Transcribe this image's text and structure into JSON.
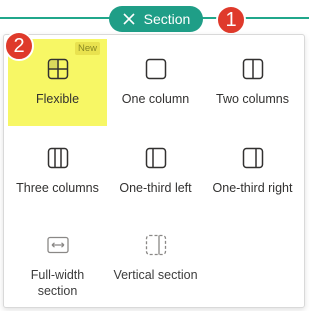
{
  "header": {
    "section_label": "Section",
    "accent_color": "#1f9e87"
  },
  "callouts": {
    "one": "1",
    "two": "2",
    "color": "#df3a2b"
  },
  "layouts": {
    "flexible": {
      "label": "Flexible",
      "badge": "New",
      "icon": "flexible-layout-icon",
      "selected": true
    },
    "one_column": {
      "label": "One column",
      "icon": "one-column-icon"
    },
    "two_columns": {
      "label": "Two columns",
      "icon": "two-columns-icon"
    },
    "three_columns": {
      "label": "Three columns",
      "icon": "three-columns-icon"
    },
    "one_third_left": {
      "label": "One-third left",
      "icon": "one-third-left-icon"
    },
    "one_third_right": {
      "label": "One-third right",
      "icon": "one-third-right-icon"
    },
    "full_width": {
      "label_line1": "Full-width",
      "label_line2": "section",
      "icon": "full-width-section-icon"
    },
    "vertical": {
      "label": "Vertical section",
      "icon": "vertical-section-icon"
    }
  },
  "highlight_color": "#f7f765"
}
